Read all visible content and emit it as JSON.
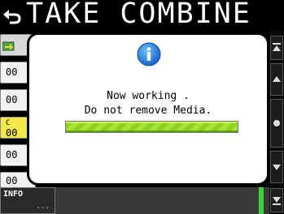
{
  "header": {
    "title": "TAKE COMBINE",
    "back_icon": "return-arrow-icon"
  },
  "list": {
    "rows": [
      "00",
      "00",
      "00",
      "00",
      "00"
    ],
    "selected_index": 2,
    "selected_badge": "C"
  },
  "dialog": {
    "icon": "info-icon",
    "line1": "Now working .",
    "line2": "Do not remove Media.",
    "progress": 1.0
  },
  "footer": {
    "info_label": "INFO",
    "info_more": "..."
  },
  "colors": {
    "background": "#000000",
    "progress_green": "#8ed21e",
    "info_blue": "#1e7fd8",
    "selected_row": "#f2e84a",
    "level_green": "#3bd23b"
  }
}
